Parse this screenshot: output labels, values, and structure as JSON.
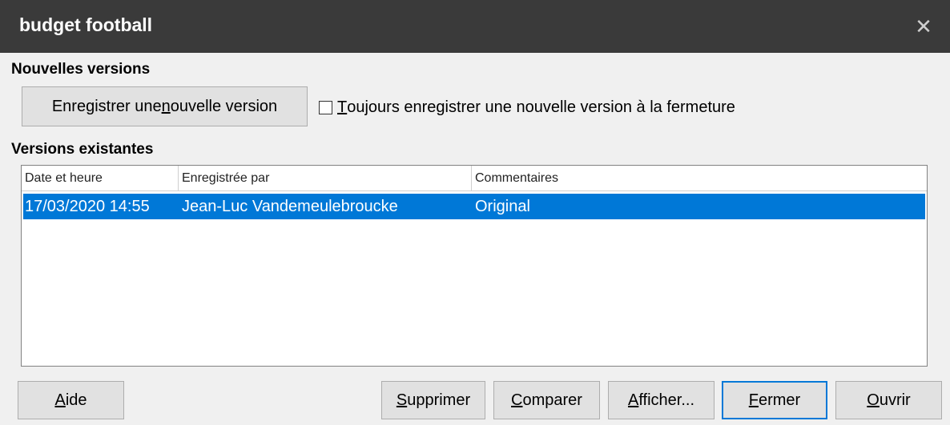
{
  "window": {
    "title": "budget football",
    "close_glyph": "✕"
  },
  "new_versions": {
    "heading": "Nouvelles versions",
    "save_button": {
      "pre": "Enregistrer une ",
      "key": "n",
      "post": "ouvelle version"
    },
    "always_save": {
      "checked": false,
      "key": "T",
      "post": "oujours enregistrer une nouvelle version à la fermeture"
    }
  },
  "existing_versions": {
    "heading": "Versions existantes",
    "columns": [
      "Date et heure",
      "Enregistrée par",
      "Commentaires"
    ],
    "rows": [
      {
        "date": "17/03/2020 14:55",
        "author": "Jean-Luc Vandemeulebroucke",
        "comment": "Original",
        "selected": true
      }
    ]
  },
  "buttons": {
    "help": {
      "key": "A",
      "post": "ide"
    },
    "delete": {
      "key": "S",
      "post": "upprimer"
    },
    "compare": {
      "key": "C",
      "post": "omparer"
    },
    "show": {
      "key": "A",
      "post": "fficher..."
    },
    "close": {
      "key": "F",
      "post": "ermer"
    },
    "open": {
      "key": "O",
      "post": "uvrir"
    }
  },
  "colors": {
    "titlebar": "#3a3a3a",
    "selection": "#0078d7",
    "dialog_bg": "#f0f0f0"
  }
}
